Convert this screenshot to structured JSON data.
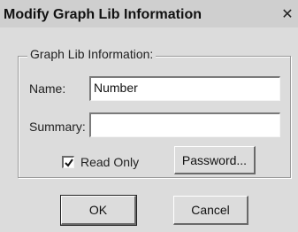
{
  "dialog": {
    "title": "Modify Graph Lib Information",
    "close_glyph": "✕",
    "group_label": "Graph Lib Information:",
    "name": {
      "label": "Name:",
      "value": "Number"
    },
    "summary": {
      "label": "Summary:",
      "value": ""
    },
    "read_only": {
      "label": "Read Only",
      "checked": true
    },
    "buttons": {
      "password": "Password...",
      "ok": "OK",
      "cancel": "Cancel"
    }
  }
}
